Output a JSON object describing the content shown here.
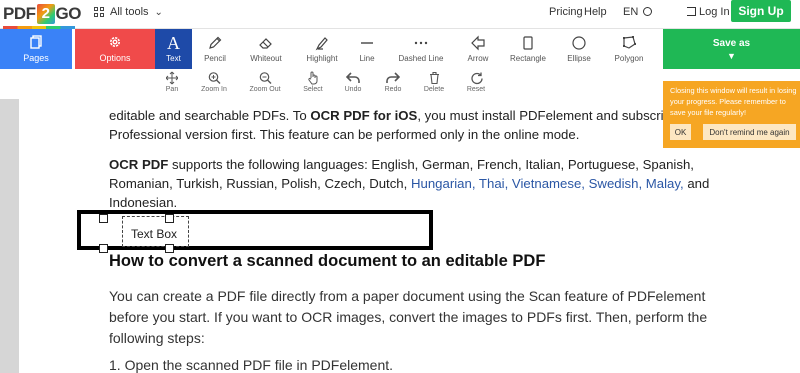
{
  "topnav": {
    "logo_left": "PDF",
    "logo_mid": "2",
    "logo_right": "GO",
    "all_tools_label": "All tools",
    "pricing_label": "Pricing",
    "help_label": "Help",
    "language_label": "EN",
    "login_label": "Log In",
    "signup_label": "Sign Up"
  },
  "toolbar": {
    "pages_label": "Pages",
    "options_label": "Options",
    "tools": [
      {
        "label": "Text",
        "icon": "text-icon",
        "active": true
      },
      {
        "label": "Pencil",
        "icon": "pencil-icon"
      },
      {
        "label": "Whiteout",
        "icon": "eraser-icon"
      },
      {
        "label": "Highlight",
        "icon": "highlighter-icon"
      },
      {
        "label": "Line",
        "icon": "line-icon"
      },
      {
        "label": "Dashed Line",
        "icon": "dashed-line-icon"
      },
      {
        "label": "Arrow",
        "icon": "arrow-icon"
      },
      {
        "label": "Rectangle",
        "icon": "rectangle-icon"
      },
      {
        "label": "Ellipse",
        "icon": "ellipse-icon"
      },
      {
        "label": "Polygon",
        "icon": "polygon-icon"
      }
    ],
    "save_as_label": "Save as"
  },
  "subtools": [
    {
      "label": "Pan",
      "icon": "pan-icon"
    },
    {
      "label": "Zoom In",
      "icon": "zoom-in-icon"
    },
    {
      "label": "Zoom Out",
      "icon": "zoom-out-icon"
    },
    {
      "label": "Select",
      "icon": "hand-pointer-icon"
    },
    {
      "label": "Undo",
      "icon": "undo-icon"
    },
    {
      "label": "Redo",
      "icon": "redo-icon"
    },
    {
      "label": "Delete",
      "icon": "trash-icon"
    },
    {
      "label": "Reset",
      "icon": "reset-icon"
    }
  ],
  "document": {
    "line1_a": "editable and searchable PDFs. To ",
    "line1_b": "OCR PDF for iOS",
    "line1_c": ", you must install PDFelement and subscribe t",
    "line2": "Professional version first. This feature can be performed only in the online mode.",
    "line3_a": "OCR PDF",
    "line3_b": " supports the following languages: English, German, French, Italian, Portuguese, Spanish,",
    "line4_a": "Romanian, Turkish, Russian, Polish, Czech, Dutch, ",
    "line4_b": "Hungarian, Thai, Vietnamese, Swedish, Malay,",
    "line4_c": " and",
    "line5": "Indonesian.",
    "text_box": "Text Box",
    "heading": "How to convert a scanned document to an editable PDF",
    "para1": "You can create a PDF file directly from a paper document using the Scan feature of PDFelement",
    "para2": "before you start. If you want to OCR images, convert the images to PDFs first. Then, perform the",
    "para3": "following steps:",
    "step1": "1. Open the scanned PDF file in PDFelement."
  },
  "toast": {
    "message": "Closing this window will result in losing your progress. Please remember to save your file regularly!",
    "ok_label": "OK",
    "remind_label": "Don't remind me again"
  },
  "colors": {
    "pages_blue": "#3a82f7",
    "options_red": "#f04a4a",
    "active_tool": "#1e4aa8",
    "save_green": "#1fb855",
    "toast_orange": "#f6a623"
  }
}
